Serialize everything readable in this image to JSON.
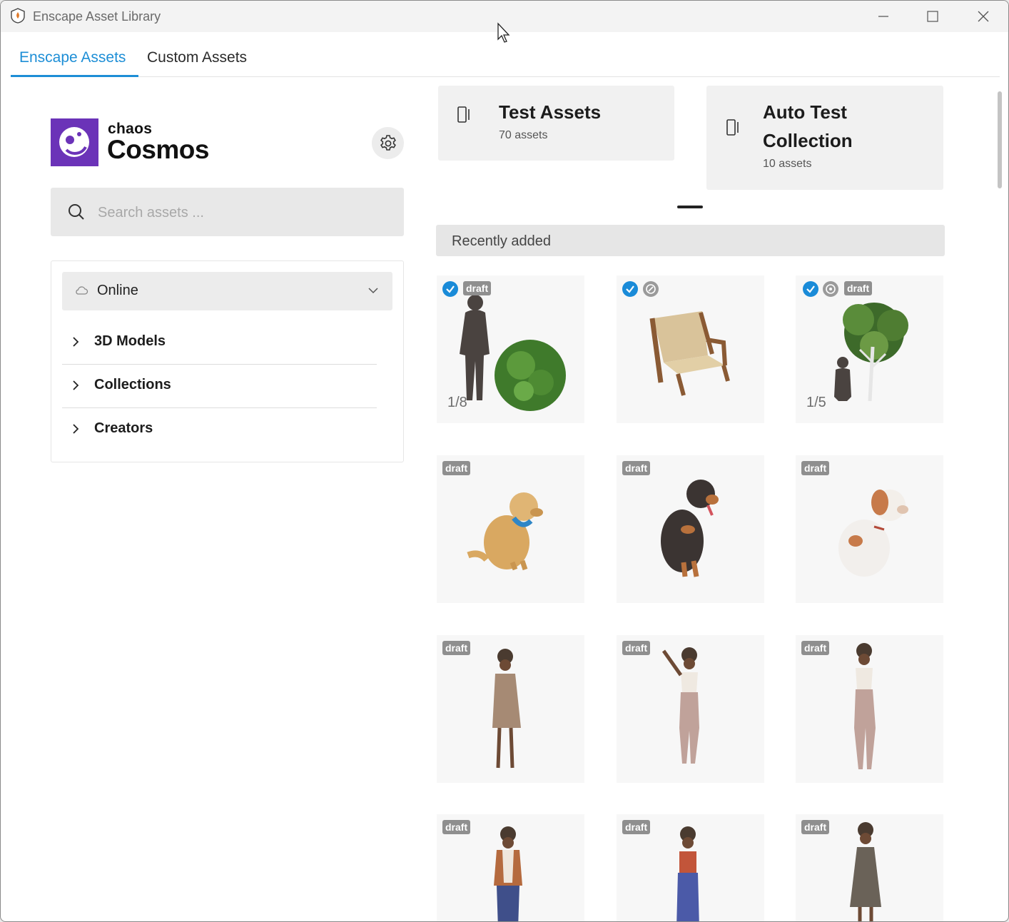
{
  "window": {
    "title": "Enscape Asset Library"
  },
  "tabs": [
    {
      "label": "Enscape Assets",
      "active": true
    },
    {
      "label": "Custom Assets",
      "active": false
    }
  ],
  "brand": {
    "small": "chaos",
    "big": "Cosmos",
    "color": "#6b33b8"
  },
  "search": {
    "placeholder": "Search assets ..."
  },
  "filter": {
    "source": "Online",
    "tree": [
      {
        "label": "3D Models"
      },
      {
        "label": "Collections"
      },
      {
        "label": "Creators"
      }
    ]
  },
  "collections": [
    {
      "name": "Test Assets",
      "count": "70 assets"
    },
    {
      "name": "Auto Test Collection",
      "count": "10 assets"
    }
  ],
  "recent": {
    "title": "Recently added",
    "draft_label": "draft",
    "items": [
      {
        "subject": "man-silhouette-and-bush",
        "checked": true,
        "status_icon": false,
        "draft": true,
        "variant": "1/8"
      },
      {
        "subject": "wooden-armchair",
        "checked": true,
        "status_icon": true,
        "draft": false
      },
      {
        "subject": "man-silhouette-and-tree",
        "checked": true,
        "status_icon": true,
        "draft": true,
        "variant": "1/5"
      },
      {
        "subject": "golden-retriever-dog",
        "checked": false,
        "status_icon": false,
        "draft": true
      },
      {
        "subject": "rottweiler-dog",
        "checked": false,
        "status_icon": false,
        "draft": true
      },
      {
        "subject": "spaniel-dog",
        "checked": false,
        "status_icon": false,
        "draft": true
      },
      {
        "subject": "woman-in-coat",
        "checked": false,
        "status_icon": false,
        "draft": true
      },
      {
        "subject": "woman-pointing-up",
        "checked": false,
        "status_icon": false,
        "draft": true
      },
      {
        "subject": "woman-standing",
        "checked": false,
        "status_icon": false,
        "draft": true
      },
      {
        "subject": "woman-in-jacket",
        "checked": false,
        "status_icon": false,
        "draft": true
      },
      {
        "subject": "woman-thinking",
        "checked": false,
        "status_icon": false,
        "draft": true
      },
      {
        "subject": "woman-in-dress",
        "checked": false,
        "status_icon": false,
        "draft": true
      }
    ]
  },
  "colors": {
    "accent": "#1d8ed6",
    "check": "#1a8bd8",
    "draft_badge": "#8f8f8f"
  }
}
